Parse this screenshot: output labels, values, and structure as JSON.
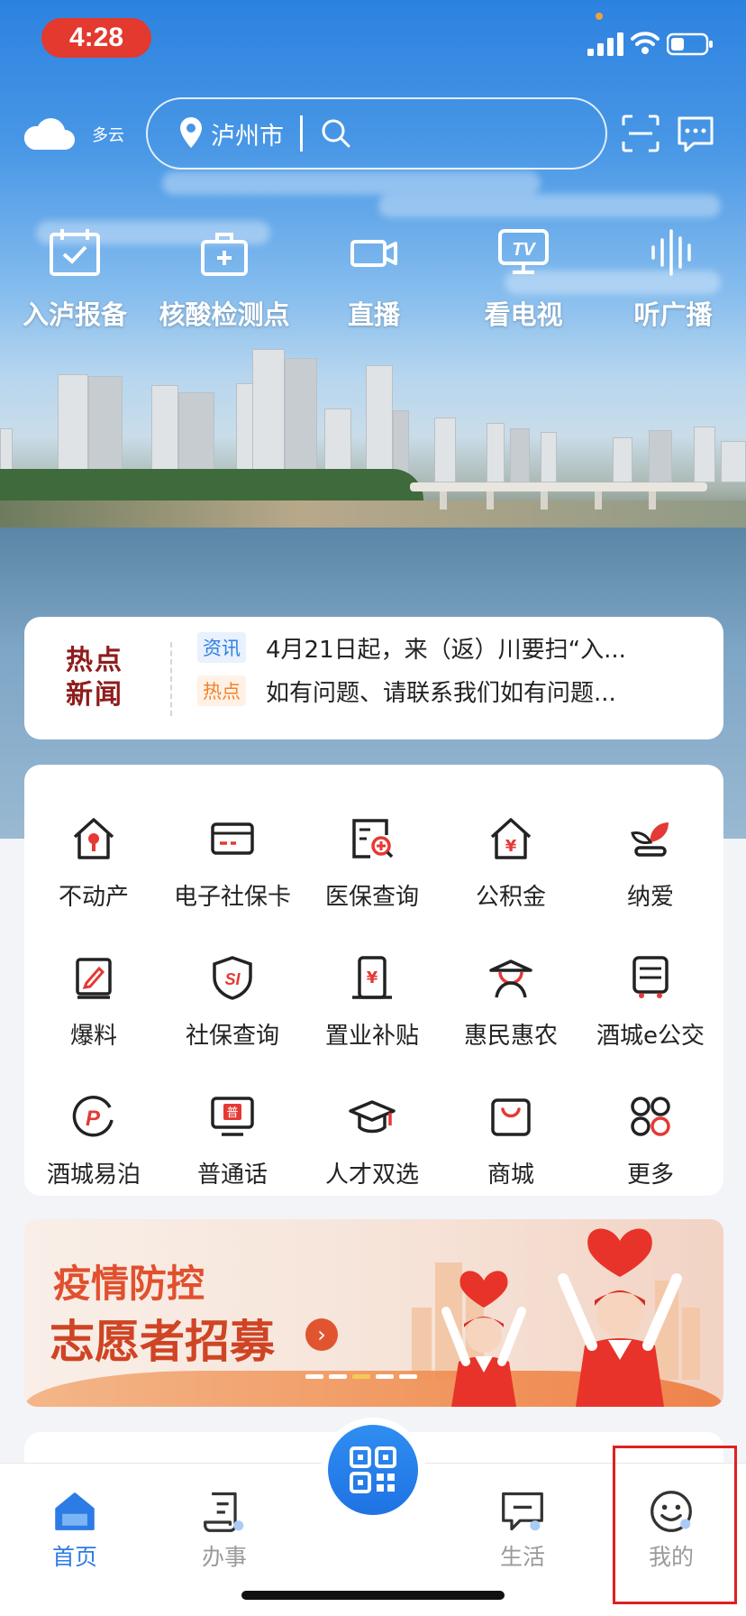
{
  "status_bar": {
    "time": "4:28"
  },
  "header": {
    "weather_text": "多云",
    "weather_icon": "cloud-icon",
    "search_city": "泸州市",
    "search_icon": "search-icon",
    "scan_icon": "scan-icon",
    "message_icon": "message-icon"
  },
  "quick_actions": [
    {
      "label": "入泸报备",
      "icon": "calendar-check-icon"
    },
    {
      "label": "核酸检测点",
      "icon": "medical-kit-icon"
    },
    {
      "label": "直播",
      "icon": "video-camera-icon"
    },
    {
      "label": "看电视",
      "icon": "tv-icon"
    },
    {
      "label": "听广播",
      "icon": "audio-wave-icon"
    }
  ],
  "hot_news": {
    "logo_line1": "热点",
    "logo_line2": "新闻",
    "items": [
      {
        "tag": "资讯",
        "text": "4月21日起，来（返）川要扫“入..."
      },
      {
        "tag": "热点",
        "text": "如有问题、请联系我们如有问题..."
      }
    ]
  },
  "services": [
    {
      "label": "不动产",
      "icon": "house-key-icon"
    },
    {
      "label": "电子社保卡",
      "icon": "card-icon"
    },
    {
      "label": "医保查询",
      "icon": "medical-search-icon"
    },
    {
      "label": "公积金",
      "icon": "house-yuan-icon"
    },
    {
      "label": "纳爱",
      "icon": "sprout-icon"
    },
    {
      "label": "爆料",
      "icon": "edit-note-icon"
    },
    {
      "label": "社保查询",
      "icon": "si-shield-icon"
    },
    {
      "label": "置业补贴",
      "icon": "yuan-phone-icon"
    },
    {
      "label": "惠民惠农",
      "icon": "farmer-icon"
    },
    {
      "label": "酒城e公交",
      "icon": "bus-icon"
    },
    {
      "label": "酒城易泊",
      "icon": "parking-icon"
    },
    {
      "label": "普通话",
      "icon": "monitor-pu-icon"
    },
    {
      "label": "人才双选",
      "icon": "graduation-cap-icon"
    },
    {
      "label": "商城",
      "icon": "shopping-bag-icon"
    },
    {
      "label": "更多",
      "icon": "more-grid-icon"
    }
  ],
  "banner": {
    "line1": "疫情防控",
    "line2": "志愿者招募",
    "arrow": "›"
  },
  "tabbar": {
    "tabs": [
      {
        "label": "首页",
        "icon": "home-icon"
      },
      {
        "label": "办事",
        "icon": "document-icon"
      },
      {
        "label": "生活",
        "icon": "chat-icon"
      },
      {
        "label": "我的",
        "icon": "smiley-icon"
      }
    ],
    "center_icon": "qr-code-icon"
  },
  "colors": {
    "accent_blue": "#2d7be5",
    "accent_red": "#e3392e",
    "banner_red": "#cf4424"
  }
}
